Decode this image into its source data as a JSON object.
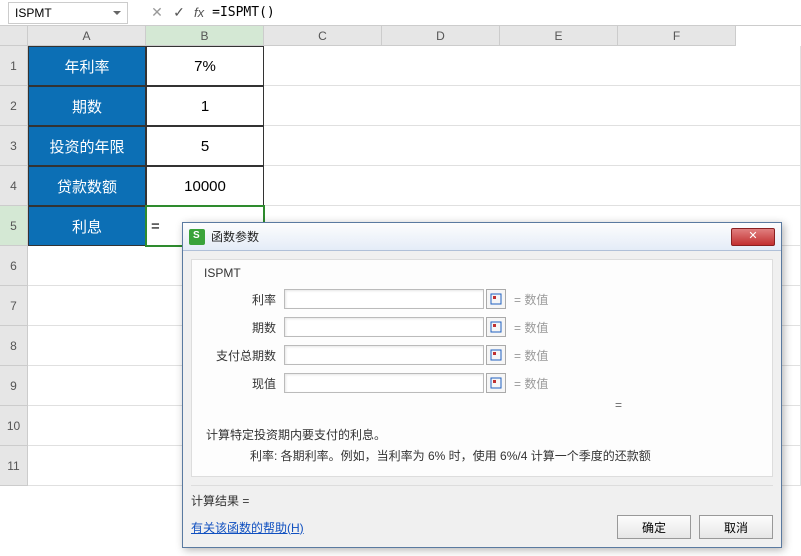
{
  "name_box": "ISPMT",
  "formula_bar": "=ISPMT()",
  "columns": [
    "A",
    "B",
    "C",
    "D",
    "E",
    "F"
  ],
  "rows": [
    "1",
    "2",
    "3",
    "4",
    "5",
    "6",
    "7",
    "8",
    "9",
    "10",
    "11"
  ],
  "data": {
    "r1a": "年利率",
    "r1b": "7%",
    "r2a": "期数",
    "r2b": "1",
    "r3a": "投资的年限",
    "r3b": "5",
    "r4a": "贷款数额",
    "r4b": "10000",
    "r5a": "利息",
    "r5b": "="
  },
  "sel_col": "B",
  "sel_row": "5",
  "dialog": {
    "title": "函数参数",
    "group": "ISPMT",
    "params": [
      {
        "label": "利率",
        "hint": "数值"
      },
      {
        "label": "期数",
        "hint": "数值"
      },
      {
        "label": "支付总期数",
        "hint": "数值"
      },
      {
        "label": "现值",
        "hint": "数值"
      }
    ],
    "desc": "计算特定投资期内要支付的利息。",
    "desc_detail": "利率:  各期利率。例如，当利率为 6% 时，使用 6%/4 计算一个季度的还款额",
    "calc": "计算结果 =",
    "help": "有关该函数的帮助(H)",
    "ok": "确定",
    "cancel": "取消"
  }
}
